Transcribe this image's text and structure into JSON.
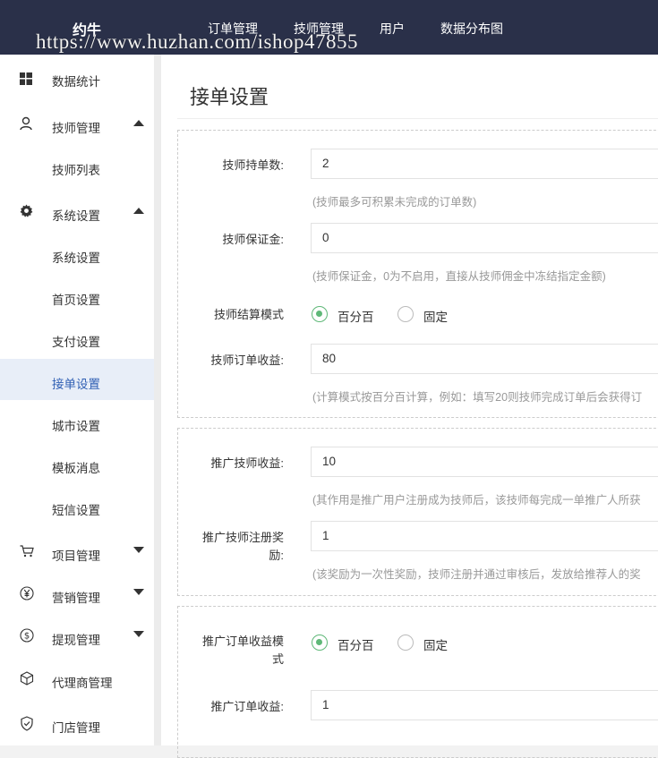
{
  "header": {
    "brand": "约牛",
    "nav": [
      "订单管理",
      "技师管理",
      "用户",
      "数据分布图"
    ],
    "watermark": "https://www.huzhan.com/ishop47855"
  },
  "sidebar": {
    "items": [
      {
        "label": "数据统计",
        "icon": "windows-grid-icon"
      },
      {
        "label": "技师管理",
        "icon": "user-icon",
        "arrow": "up"
      },
      {
        "label": "技师列表"
      },
      {
        "label": "系统设置",
        "icon": "gear-icon",
        "arrow": "up"
      },
      {
        "label": "系统设置"
      },
      {
        "label": "首页设置"
      },
      {
        "label": "支付设置"
      },
      {
        "label": "接单设置",
        "active": true
      },
      {
        "label": "城市设置"
      },
      {
        "label": "模板消息"
      },
      {
        "label": "短信设置"
      },
      {
        "label": "项目管理",
        "icon": "cart-icon",
        "arrow": "down"
      },
      {
        "label": "营销管理",
        "icon": "yen-icon",
        "arrow": "down"
      },
      {
        "label": "提现管理",
        "icon": "dollar-icon",
        "arrow": "down"
      },
      {
        "label": "代理商管理",
        "icon": "cube-icon"
      },
      {
        "label": "门店管理",
        "icon": "shield-icon"
      }
    ]
  },
  "main": {
    "title": "接单设置",
    "groups": [
      {
        "fields": [
          {
            "label": "技师持单数:",
            "value": "2",
            "hint": "(技师最多可积累未完成的订单数)"
          },
          {
            "label": "技师保证金:",
            "value": "0",
            "hint": "(技师保证金，0为不启用，直接从技师佣金中冻结指定金额)"
          },
          {
            "label": "技师结算模式",
            "options": [
              "百分百",
              "固定"
            ],
            "selected": "百分百"
          },
          {
            "label": "技师订单收益:",
            "value": "80",
            "hint": "(计算模式按百分百计算，例如：填写20则技师完成订单后会获得订"
          }
        ]
      },
      {
        "fields": [
          {
            "label": "推广技师收益:",
            "value": "10",
            "hint": "(其作用是推广用户注册成为技师后，该技师每完成一单推广人所获"
          },
          {
            "label": "推广技师注册奖励:",
            "label_lines": [
              "推广技师注册奖",
              "励:"
            ],
            "value": "1",
            "hint": "(该奖励为一次性奖励，技师注册并通过审核后，发放给推荐人的奖"
          }
        ]
      },
      {
        "fields": [
          {
            "label": "推广订单收益模式",
            "label_lines": [
              "推广订单收益模",
              "式"
            ],
            "options": [
              "百分百",
              "固定"
            ],
            "selected": "百分百"
          },
          {
            "label": "推广订单收益:",
            "value": "1"
          }
        ]
      }
    ]
  }
}
